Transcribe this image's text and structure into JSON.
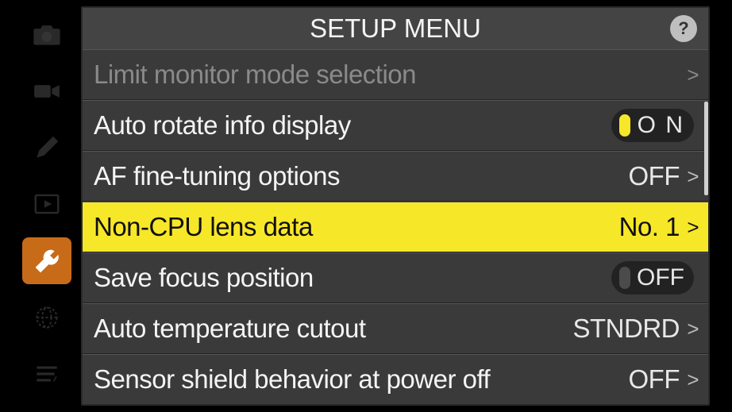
{
  "header": {
    "title": "SETUP MENU",
    "help": "?"
  },
  "sidebar": {
    "items": [
      {
        "name": "camera",
        "active": false
      },
      {
        "name": "video",
        "active": false
      },
      {
        "name": "pencil",
        "active": false
      },
      {
        "name": "playback",
        "active": false
      },
      {
        "name": "setup",
        "active": true
      },
      {
        "name": "network",
        "active": false
      },
      {
        "name": "mymenu",
        "active": false
      }
    ]
  },
  "menu": {
    "rows": [
      {
        "label": "Limit monitor mode selection",
        "value": "",
        "chevron": ">",
        "disabled": true,
        "highlight": false,
        "toggle": null
      },
      {
        "label": "Auto rotate info display",
        "value": "",
        "chevron": "",
        "disabled": false,
        "highlight": false,
        "toggle": {
          "state": "on",
          "text": "O N"
        }
      },
      {
        "label": "AF fine-tuning options",
        "value": "OFF",
        "chevron": ">",
        "disabled": false,
        "highlight": false,
        "toggle": null
      },
      {
        "label": "Non-CPU lens data",
        "value": "No. 1",
        "chevron": ">",
        "disabled": false,
        "highlight": true,
        "toggle": null
      },
      {
        "label": "Save focus position",
        "value": "",
        "chevron": "",
        "disabled": false,
        "highlight": false,
        "toggle": {
          "state": "off",
          "text": "OFF"
        }
      },
      {
        "label": "Auto temperature cutout",
        "value": "STNDRD",
        "chevron": ">",
        "disabled": false,
        "highlight": false,
        "toggle": null
      },
      {
        "label": "Sensor shield behavior at power off",
        "value": "OFF",
        "chevron": ">",
        "disabled": false,
        "highlight": false,
        "toggle": null
      }
    ]
  }
}
